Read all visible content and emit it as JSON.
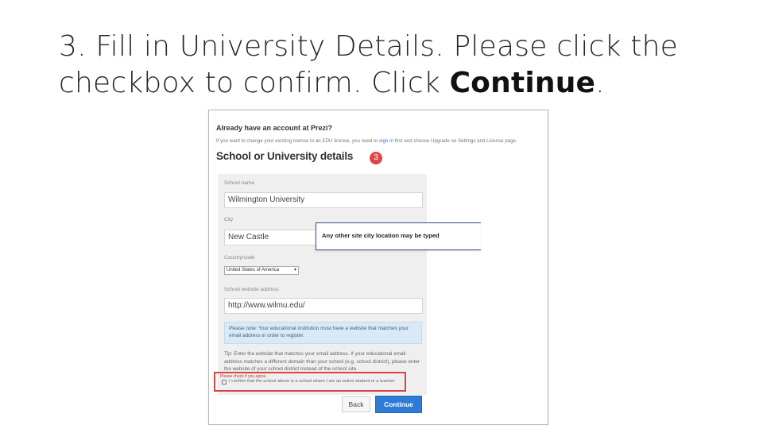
{
  "slide": {
    "title_line1": "3. Fill in University Details. Please click the",
    "title_line2_prefix": "checkbox to confirm. Click ",
    "title_emphasis": "Continue",
    "title_suffix": "."
  },
  "form": {
    "have_account": "Already have an account at Prezi?",
    "license_text_1": "If you want to change your existing license to an EDU license, you need to ",
    "license_link": "sign in",
    "license_text_2": " first and choose Upgrade on Settings and License page.",
    "section_title": "School or University details",
    "step_badge": "3",
    "fields": {
      "school_name": {
        "label": "School name",
        "value": "Wilmington University"
      },
      "city": {
        "label": "City",
        "value": "New Castle"
      },
      "country": {
        "label": "Country/code",
        "value": "United States of America"
      },
      "website": {
        "label": "School website address",
        "value": "http://www.wilmu.edu/"
      }
    },
    "note": "Please note: Your educational institution must have a website that matches your email address in order to register.",
    "tip": "Tip: Enter the website that matches your email address. If your educational email address matches a different domain than your school (e.g. school district), please enter the website of your school district instead of the school site.",
    "please_check": "Please check if you agree.",
    "confirm_label": "I confirm that the school above is a school where I am an active student or a teacher",
    "back_label": "Back",
    "continue_label": "Continue"
  },
  "callout": {
    "text": "Any other site city location may be typed"
  },
  "colors": {
    "accent_blue": "#2e7bd6",
    "highlight_red": "#d64545",
    "note_blue": "#d9e9f6"
  }
}
